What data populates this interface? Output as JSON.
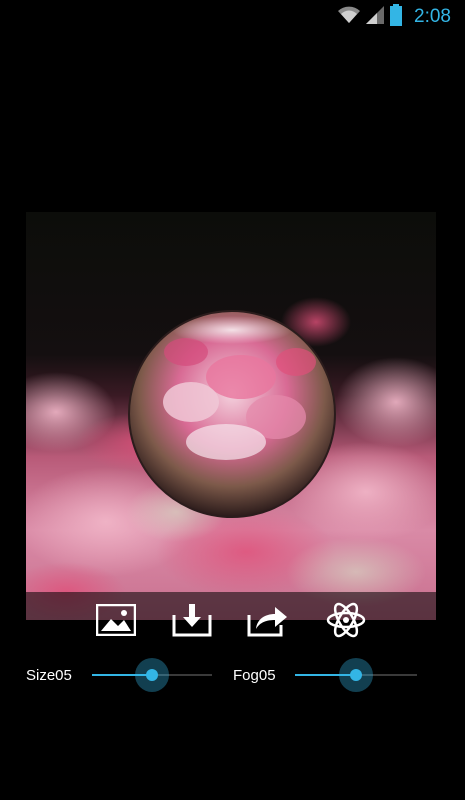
{
  "status_bar": {
    "time": "2:08",
    "icons": [
      "wifi-icon",
      "signal-icon",
      "battery-icon"
    ],
    "accent_color": "#33b5e5"
  },
  "photo": {
    "description_icon": "crystal-ball-flower-photo"
  },
  "toolbar": {
    "buttons": [
      {
        "icon": "gallery-image-icon"
      },
      {
        "icon": "download-icon"
      },
      {
        "icon": "share-icon"
      },
      {
        "icon": "atom-icon"
      }
    ]
  },
  "sliders": {
    "size": {
      "label": "Size05",
      "value_fraction": 0.5
    },
    "fog": {
      "label": "Fog05",
      "value_fraction": 0.5
    }
  },
  "colors": {
    "accent": "#33b5e5",
    "background": "#000000"
  }
}
